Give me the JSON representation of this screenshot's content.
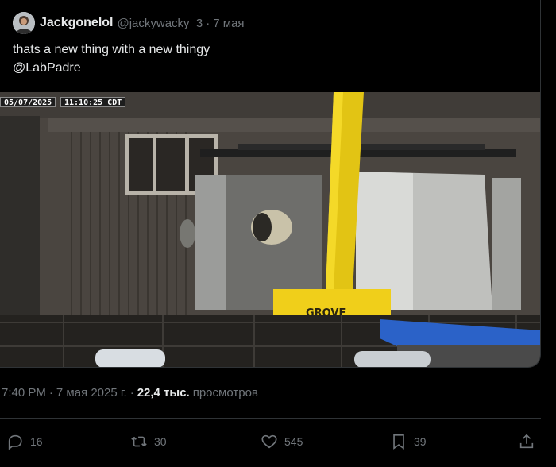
{
  "quoted_tweet": {
    "author_name": "Jackgonelol",
    "author_handle": "@jackywacky_3",
    "separator": "·",
    "date": "7 мая",
    "text_line1": "thats a new thing with a new thingy",
    "text_line2": "@LabPadre",
    "media": {
      "date_stamp": "05/07/2025",
      "time_stamp": "11:10:25 CDT",
      "crane_label": "GROVE"
    }
  },
  "tweet_meta": {
    "time": "7:40 PM",
    "dot": "·",
    "date": "7 мая 2025 г.",
    "views_count": "22,4 тыс.",
    "views_label": "просмотров"
  },
  "actions": {
    "replies": "16",
    "retweets": "30",
    "likes": "545",
    "bookmarks": "39"
  },
  "icons": [
    "reply-icon",
    "retweet-icon",
    "like-icon",
    "bookmark-icon",
    "share-icon"
  ]
}
